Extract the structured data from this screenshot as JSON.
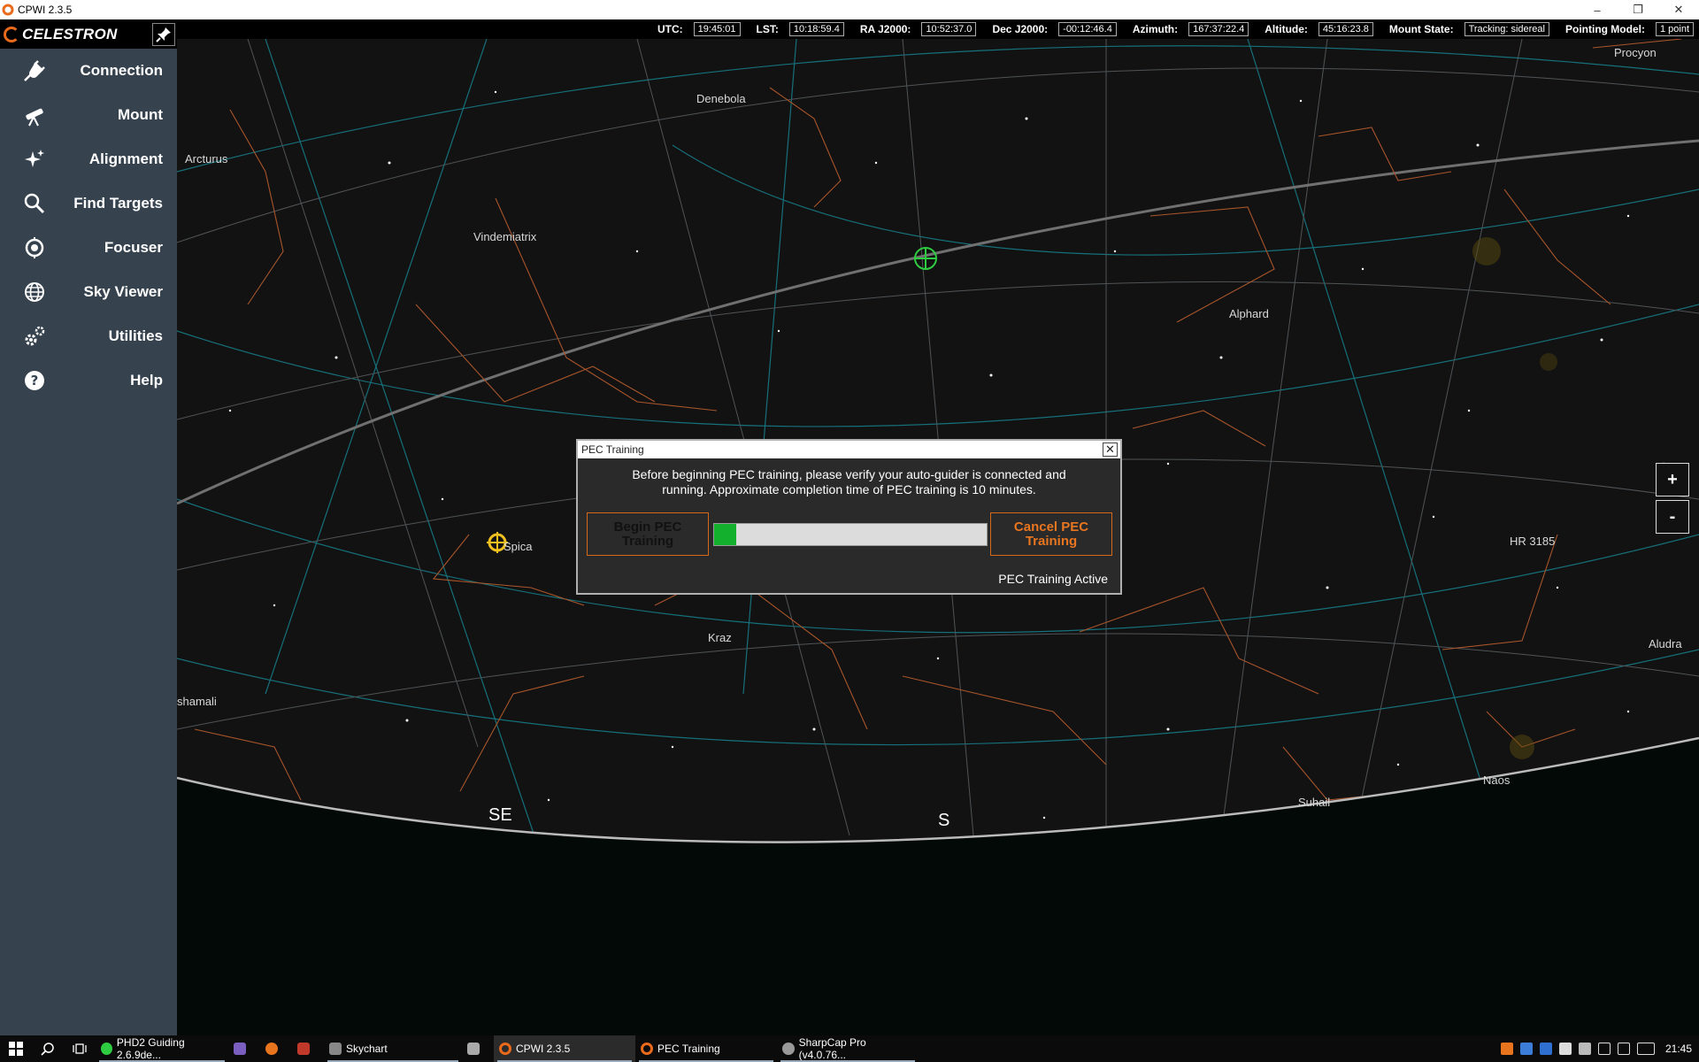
{
  "window": {
    "title": "CPWI 2.3.5",
    "controls": [
      "–",
      "❐",
      "✕"
    ]
  },
  "brand": "CELESTRON",
  "sidebar": {
    "items": [
      {
        "label": "Connection",
        "icon": "plug-icon"
      },
      {
        "label": "Mount",
        "icon": "telescope-icon"
      },
      {
        "label": "Alignment",
        "icon": "sparkle-icon"
      },
      {
        "label": "Find Targets",
        "icon": "search-icon"
      },
      {
        "label": "Focuser",
        "icon": "focus-icon"
      },
      {
        "label": "Sky Viewer",
        "icon": "globe-icon"
      },
      {
        "label": "Utilities",
        "icon": "gears-icon"
      },
      {
        "label": "Help",
        "icon": "help-icon"
      }
    ]
  },
  "status": {
    "utc": {
      "label": "UTC:",
      "value": "19:45:01"
    },
    "lst": {
      "label": "LST:",
      "value": "10:18:59.4"
    },
    "ra": {
      "label": "RA J2000:",
      "value": "10:52:37.0"
    },
    "dec": {
      "label": "Dec J2000:",
      "value": "-00:12:46.4"
    },
    "az": {
      "label": "Azimuth:",
      "value": "167:37:22.4"
    },
    "alt": {
      "label": "Altitude:",
      "value": "45:16:23.8"
    },
    "mount": {
      "label": "Mount State:",
      "value": "Tracking: sidereal"
    },
    "model": {
      "label": "Pointing Model:",
      "value": "1 point"
    }
  },
  "sky": {
    "labels": [
      "Procyon",
      "Denebola",
      "Arcturus",
      "Vindemiatrix",
      "Alphard",
      "Spica",
      "HR 3185",
      "Kraz",
      "Aludra",
      "shamali",
      "Naos",
      "Suhail"
    ],
    "compass": [
      "SE",
      "S"
    ],
    "zoom_in": "+",
    "zoom_out": "-"
  },
  "dialog": {
    "title": "PEC Training",
    "close": "✕",
    "message_line1": "Before beginning PEC training, please verify your auto-guider is connected and",
    "message_line2": "running. Approximate completion time of PEC training is 10 minutes.",
    "begin_label": "Begin PEC Training",
    "cancel_label": "Cancel PEC Training",
    "progress": 0.08,
    "status": "PEC Training Active"
  },
  "taskbar": {
    "apps": [
      {
        "label": "PHD2 Guiding 2.6.9de...",
        "color": "#2ecc40",
        "open": true
      },
      {
        "label": "",
        "color": "#7a5fc0",
        "open": false
      },
      {
        "label": "",
        "color": "#e8741d",
        "open": false
      },
      {
        "label": "",
        "color": "#c0392b",
        "open": false
      },
      {
        "label": "Skychart",
        "color": "#888888",
        "open": true
      },
      {
        "label": "",
        "color": "#aaaaaa",
        "open": false
      },
      {
        "label": "CPWI 2.3.5",
        "color": "#e86a1a",
        "open": true,
        "active": true
      },
      {
        "label": "PEC Training",
        "color": "#e86a1a",
        "open": true
      },
      {
        "label": "SharpCap Pro (v4.0.76...",
        "color": "#999999",
        "open": true
      }
    ],
    "clock": "21:45"
  }
}
